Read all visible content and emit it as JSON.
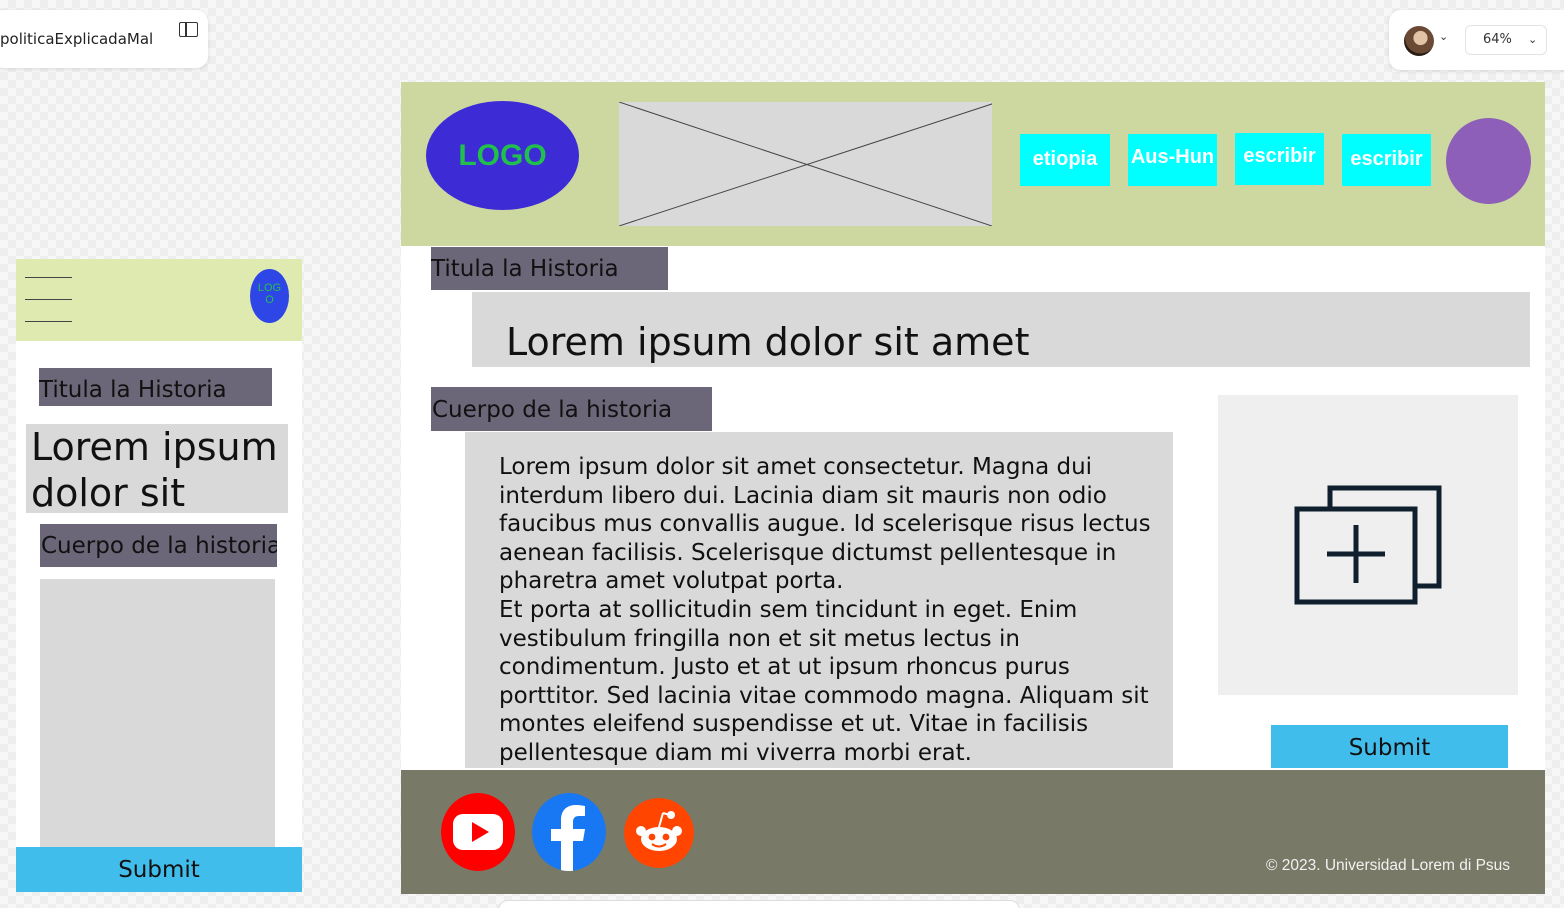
{
  "toolbar": {
    "file_name": "politicaExplicadaMal",
    "zoom": "64%",
    "chevron": "⌄"
  },
  "mobile": {
    "logo": "LOG\nO",
    "title_label": "Titula la Historia",
    "headline": "Lorem ipsum dolor sit amet",
    "body_label": "Cuerpo de la historia",
    "submit": "Submit"
  },
  "desktop": {
    "logo": "LOGO",
    "nav": [
      "etiopia",
      "Aus-Hun",
      "escribir",
      "escribir"
    ],
    "title_label": "Titula la Historia",
    "headline": "Lorem ipsum dolor sit amet",
    "body_label": "Cuerpo de la historia",
    "body_text": [
      "Lorem ipsum dolor sit amet consectetur. Magna dui interdum libero dui. Lacinia diam sit mauris non odio faucibus mus convallis augue. Id scelerisque risus lectus aenean facilisis. Scelerisque dictumst pellentesque in pharetra amet volutpat porta.",
      "Et porta at sollicitudin sem tincidunt in eget. Enim vestibulum fringilla non et sit metus lectus in condimentum. Justo et at ut ipsum rhoncus purus porttitor. Sed lacinia vitae commodo magna. Aliquam sit montes eleifend suspendisse et ut. Vitae in facilisis pellentesque diam mi viverra morbi erat."
    ],
    "submit": "Submit",
    "footer_icons": [
      "youtube-icon",
      "facebook-icon",
      "reddit-icon"
    ],
    "copyright": "© 2023. Universidad Lorem di Psus"
  },
  "colors": {
    "mobile_header": "#dfeab0",
    "desktop_header": "#cdd8a1",
    "label_box": "#6b6778",
    "nav_button": "#00ffff",
    "submit": "#41bdec",
    "footer": "#787a67",
    "profile": "#8e5fb8"
  }
}
